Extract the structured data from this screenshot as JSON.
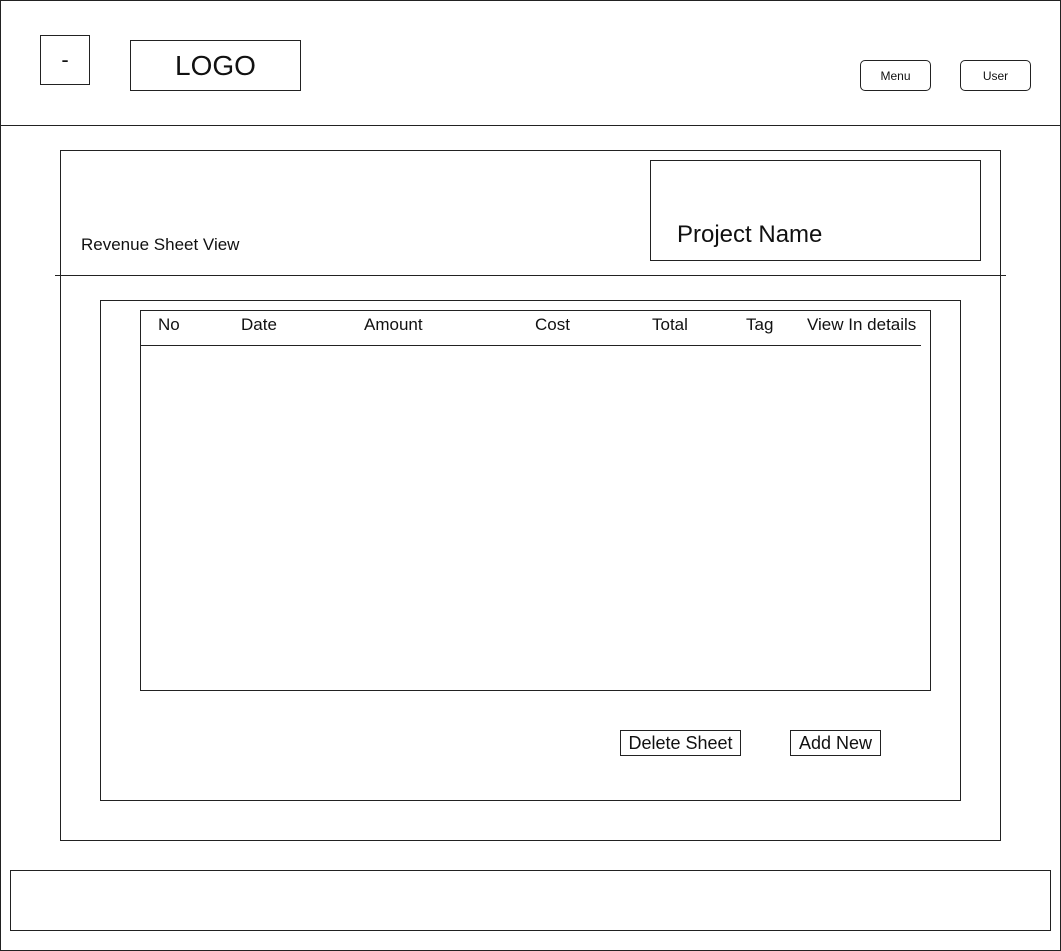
{
  "header": {
    "toggle_label": "-",
    "logo_text": "LOGO",
    "menu_label": "Menu",
    "user_label": "User"
  },
  "main": {
    "sheet_title": "Revenue Sheet View",
    "project_name": "Project Name"
  },
  "table": {
    "columns": [
      "No",
      "Date",
      "Amount",
      "Cost",
      "Total",
      "Tag",
      "View In details"
    ],
    "rows": []
  },
  "actions": {
    "delete_label": "Delete Sheet",
    "add_label": "Add New"
  }
}
